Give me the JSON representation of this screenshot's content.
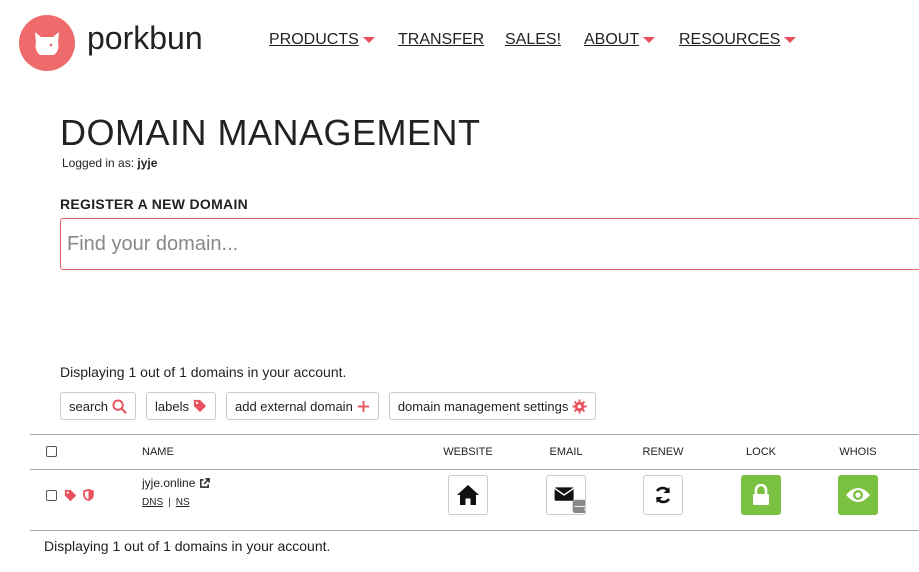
{
  "brand": {
    "name": "porkbun",
    "logo_color": "#ef6b6b"
  },
  "nav": {
    "items": [
      {
        "label": "PRODUCTS",
        "has_dropdown": true
      },
      {
        "label": "TRANSFER",
        "has_dropdown": false
      },
      {
        "label": "SALES!",
        "has_dropdown": false
      },
      {
        "label": "ABOUT",
        "has_dropdown": true
      },
      {
        "label": "RESOURCES",
        "has_dropdown": true
      }
    ],
    "caret_color": "#e8505b"
  },
  "page": {
    "title": "DOMAIN MANAGEMENT",
    "logged_in_prefix": "Logged in as:",
    "username": "jyje"
  },
  "register": {
    "label": "REGISTER A NEW DOMAIN",
    "placeholder": "Find your domain..."
  },
  "summary": "Displaying 1 out of 1 domains in your account.",
  "toolbar": {
    "search_label": "search",
    "labels_label": "labels",
    "add_external_label": "add external domain",
    "settings_label": "domain management settings",
    "icon_color": "#e8505b"
  },
  "table": {
    "columns": {
      "name": "NAME",
      "website": "WEBSITE",
      "email": "EMAIL",
      "renew": "RENEW",
      "lock": "LOCK",
      "whois": "WHOIS"
    },
    "rows": [
      {
        "domain": "jyje.online",
        "dns_label": "DNS",
        "ns_label": "NS",
        "lock_color": "#7ac142",
        "whois_color": "#7ac142"
      }
    ]
  }
}
